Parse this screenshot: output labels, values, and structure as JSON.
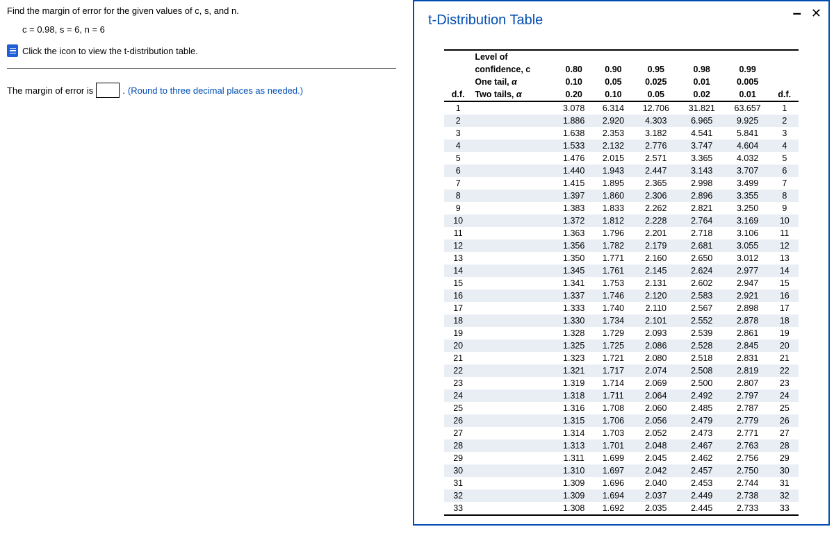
{
  "question": {
    "line1": "Find the margin of error for the given values of c, s, and n.",
    "params": "c = 0.98, s = 6, n = 6",
    "click_text": "Click the icon to view the t-distribution table.",
    "answer_prefix": "The margin of error is",
    "answer_suffix": ".",
    "round_text": "(Round to three decimal places as needed.)"
  },
  "modal": {
    "title": "t-Distribution Table",
    "minus": "–",
    "close": "✕"
  },
  "chart_data": {
    "type": "table",
    "title": "t-Distribution Table",
    "header_rows": [
      {
        "label": "Level of confidence, c",
        "values": [
          "0.80",
          "0.90",
          "0.95",
          "0.98",
          "0.99"
        ]
      },
      {
        "label": "One tail, α",
        "values": [
          "0.10",
          "0.05",
          "0.025",
          "0.01",
          "0.005"
        ]
      },
      {
        "label": "Two tails, α",
        "values": [
          "0.20",
          "0.10",
          "0.05",
          "0.02",
          "0.01"
        ]
      }
    ],
    "df_label": "d.f.",
    "rows": [
      {
        "df": 1,
        "v": [
          "3.078",
          "6.314",
          "12.706",
          "31.821",
          "63.657"
        ]
      },
      {
        "df": 2,
        "v": [
          "1.886",
          "2.920",
          "4.303",
          "6.965",
          "9.925"
        ]
      },
      {
        "df": 3,
        "v": [
          "1.638",
          "2.353",
          "3.182",
          "4.541",
          "5.841"
        ]
      },
      {
        "df": 4,
        "v": [
          "1.533",
          "2.132",
          "2.776",
          "3.747",
          "4.604"
        ]
      },
      {
        "df": 5,
        "v": [
          "1.476",
          "2.015",
          "2.571",
          "3.365",
          "4.032"
        ]
      },
      {
        "df": 6,
        "v": [
          "1.440",
          "1.943",
          "2.447",
          "3.143",
          "3.707"
        ]
      },
      {
        "df": 7,
        "v": [
          "1.415",
          "1.895",
          "2.365",
          "2.998",
          "3.499"
        ]
      },
      {
        "df": 8,
        "v": [
          "1.397",
          "1.860",
          "2.306",
          "2.896",
          "3.355"
        ]
      },
      {
        "df": 9,
        "v": [
          "1.383",
          "1.833",
          "2.262",
          "2.821",
          "3.250"
        ]
      },
      {
        "df": 10,
        "v": [
          "1.372",
          "1.812",
          "2.228",
          "2.764",
          "3.169"
        ]
      },
      {
        "df": 11,
        "v": [
          "1.363",
          "1.796",
          "2.201",
          "2.718",
          "3.106"
        ]
      },
      {
        "df": 12,
        "v": [
          "1.356",
          "1.782",
          "2.179",
          "2.681",
          "3.055"
        ]
      },
      {
        "df": 13,
        "v": [
          "1.350",
          "1.771",
          "2.160",
          "2.650",
          "3.012"
        ]
      },
      {
        "df": 14,
        "v": [
          "1.345",
          "1.761",
          "2.145",
          "2.624",
          "2.977"
        ]
      },
      {
        "df": 15,
        "v": [
          "1.341",
          "1.753",
          "2.131",
          "2.602",
          "2.947"
        ]
      },
      {
        "df": 16,
        "v": [
          "1.337",
          "1.746",
          "2.120",
          "2.583",
          "2.921"
        ]
      },
      {
        "df": 17,
        "v": [
          "1.333",
          "1.740",
          "2.110",
          "2.567",
          "2.898"
        ]
      },
      {
        "df": 18,
        "v": [
          "1.330",
          "1.734",
          "2.101",
          "2.552",
          "2.878"
        ]
      },
      {
        "df": 19,
        "v": [
          "1.328",
          "1.729",
          "2.093",
          "2.539",
          "2.861"
        ]
      },
      {
        "df": 20,
        "v": [
          "1.325",
          "1.725",
          "2.086",
          "2.528",
          "2.845"
        ]
      },
      {
        "df": 21,
        "v": [
          "1.323",
          "1.721",
          "2.080",
          "2.518",
          "2.831"
        ]
      },
      {
        "df": 22,
        "v": [
          "1.321",
          "1.717",
          "2.074",
          "2.508",
          "2.819"
        ]
      },
      {
        "df": 23,
        "v": [
          "1.319",
          "1.714",
          "2.069",
          "2.500",
          "2.807"
        ]
      },
      {
        "df": 24,
        "v": [
          "1.318",
          "1.711",
          "2.064",
          "2.492",
          "2.797"
        ]
      },
      {
        "df": 25,
        "v": [
          "1.316",
          "1.708",
          "2.060",
          "2.485",
          "2.787"
        ]
      },
      {
        "df": 26,
        "v": [
          "1.315",
          "1.706",
          "2.056",
          "2.479",
          "2.779"
        ]
      },
      {
        "df": 27,
        "v": [
          "1.314",
          "1.703",
          "2.052",
          "2.473",
          "2.771"
        ]
      },
      {
        "df": 28,
        "v": [
          "1.313",
          "1.701",
          "2.048",
          "2.467",
          "2.763"
        ]
      },
      {
        "df": 29,
        "v": [
          "1.311",
          "1.699",
          "2.045",
          "2.462",
          "2.756"
        ]
      },
      {
        "df": 30,
        "v": [
          "1.310",
          "1.697",
          "2.042",
          "2.457",
          "2.750"
        ]
      },
      {
        "df": 31,
        "v": [
          "1.309",
          "1.696",
          "2.040",
          "2.453",
          "2.744"
        ]
      },
      {
        "df": 32,
        "v": [
          "1.309",
          "1.694",
          "2.037",
          "2.449",
          "2.738"
        ]
      },
      {
        "df": 33,
        "v": [
          "1.308",
          "1.692",
          "2.035",
          "2.445",
          "2.733"
        ]
      }
    ]
  }
}
